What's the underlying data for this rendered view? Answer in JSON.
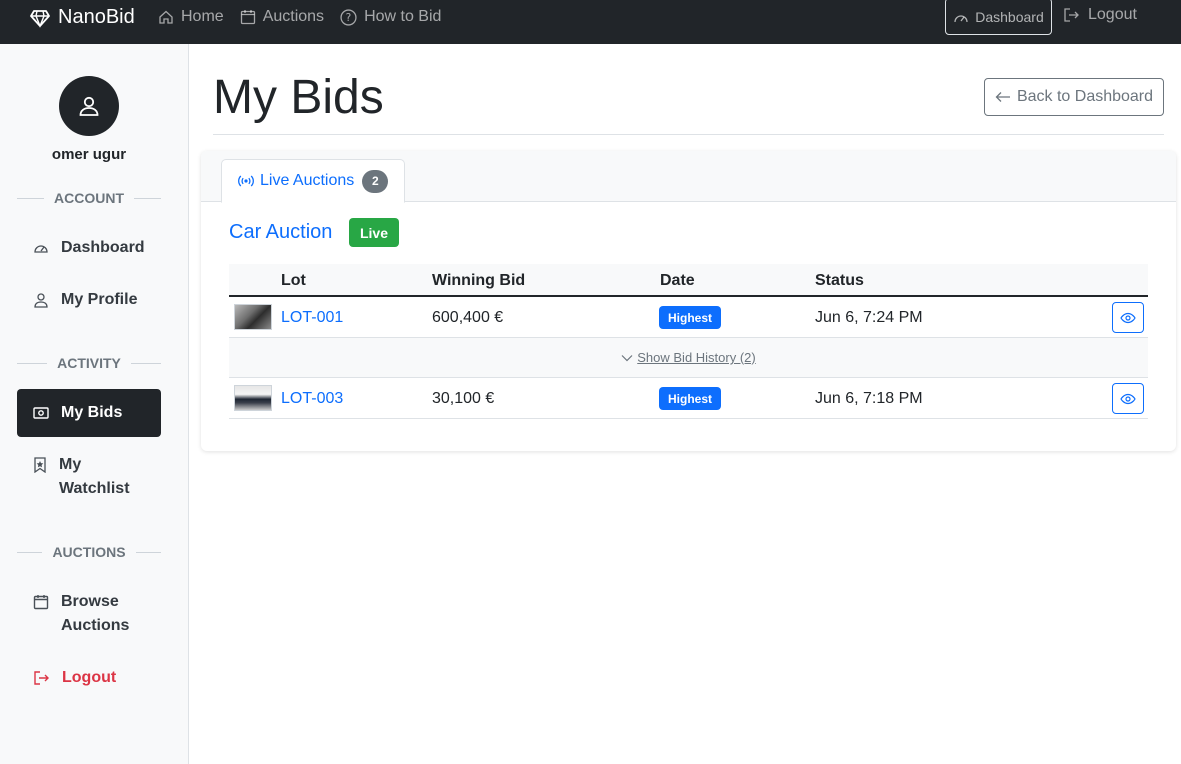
{
  "nav": {
    "brand": "NanoBid",
    "links": [
      "Home",
      "Auctions",
      "How to Bid"
    ],
    "dashboard": "Dashboard",
    "logout": "Logout"
  },
  "sidebar": {
    "username": "omer ugur",
    "sections": {
      "account": "ACCOUNT",
      "activity": "ACTIVITY",
      "auctions": "AUCTIONS"
    },
    "items": {
      "dashboard": "Dashboard",
      "profile": "My Profile",
      "bids": "My Bids",
      "watchlist": "My Watchlist",
      "browse": "Browse Auctions",
      "logout": "Logout"
    }
  },
  "main": {
    "title": "My Bids",
    "back_button": "Back to Dashboard",
    "tab": {
      "label": "Live Auctions",
      "count": "2"
    },
    "auction": {
      "title": "Car Auction",
      "badge": "Live"
    },
    "table": {
      "headers": [
        "Lot",
        "Winning Bid",
        "Date",
        "Status"
      ],
      "rows": [
        {
          "lot": "LOT-001",
          "bid": "600,400 €",
          "status": "Highest",
          "date": "Jun 6, 7:24 PM"
        },
        {
          "lot": "LOT-003",
          "bid": "30,100 €",
          "status": "Highest",
          "date": "Jun 6, 7:18 PM"
        }
      ],
      "history_link": "Show Bid History (2)"
    }
  },
  "colors": {
    "nav_bg": "#212529",
    "primary": "#0d6efd",
    "success": "#28a745",
    "danger": "#dc3545"
  }
}
